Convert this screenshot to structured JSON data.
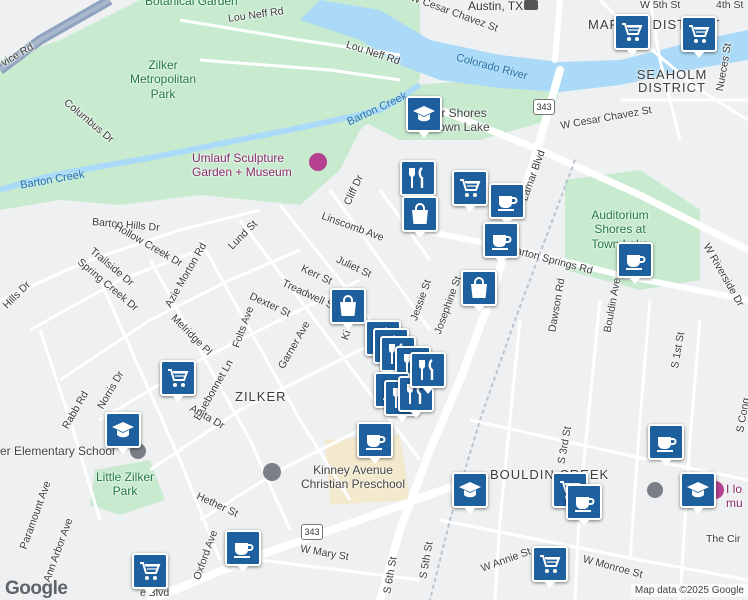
{
  "map": {
    "attribution": "Map data ©2025 Google",
    "logo": "Google",
    "colors": {
      "water": "#aadaf7",
      "park": "#c8ebd0",
      "road": "#ffffff",
      "highway": "#8fa3bf",
      "marker": "#1e5f9e",
      "school_area": "#f3e9cc"
    },
    "water_labels": [
      "Colorado River",
      "Barton Creek",
      "Barton Creek"
    ],
    "park_labels": [
      "Botanical Garden",
      "Zilker Metropolitan Park",
      "Auditorium Shores at Town Lake",
      "Little Zilker Park"
    ],
    "district_labels": [
      "MARKET DISTRICT",
      "SEAHOLM DISTRICT",
      "ZILKER",
      "BOULDIN CREEK"
    ],
    "city_label": "Austin, TX",
    "poi_labels": {
      "umlauf": "Umlauf Sculpture Garden + Museum",
      "kinney": "Kinney Avenue Christian Preschool",
      "elementary": "er Elementary School",
      "shores": "r Shores own Lake",
      "museum": "I lo mu"
    },
    "highway_shields": [
      "343",
      "343"
    ],
    "streets": [
      "Lou Neff Rd",
      "Lou Neff Rd",
      "W Cesar Chavez St",
      "W Cesar Chavez St",
      "vice Rd",
      "Columbus Dr",
      "Barton Hills Dr",
      "Hollow Creek Dr",
      "Trailside Dr",
      "Spring Creek Dr",
      "Hills Dr",
      "Azie Morton Rd",
      "Lund St",
      "Cliff Dr",
      "Linscomb Ave",
      "Juliet St",
      "Kerr St",
      "Treadwell St",
      "Dexter St",
      "Folts Ave",
      "Garner Ave",
      "Melridge Pl",
      "Bluebonnet Ln",
      "Anita Dr",
      "Norris Dr",
      "Rabb Rd",
      "Paramount Ave",
      "Ann Arbor Ave",
      "Hether St",
      "Oxford Ave",
      "W Mary St",
      "W Annie St",
      "W Monroe St",
      "S 5th St",
      "S 6th St",
      "S 3rd St",
      "S 1st St",
      "Bouldin Ave",
      "Dawson Rd",
      "W Riverside Dr",
      "Barton Springs Rd",
      "S Lamar Blvd",
      "Jessie St",
      "Josephine St",
      "The Cir",
      "S Cong",
      "Nueces St",
      "W 5th St",
      "4th St",
      "e Blvd",
      "Ki"
    ],
    "markers": [
      {
        "icon": "school"
      },
      {
        "icon": "shopping-cart"
      },
      {
        "icon": "shopping-cart"
      },
      {
        "icon": "restaurant"
      },
      {
        "icon": "shopping-cart"
      },
      {
        "icon": "shopping-bag"
      },
      {
        "icon": "coffee"
      },
      {
        "icon": "coffee"
      },
      {
        "icon": "coffee"
      },
      {
        "icon": "shopping-bag"
      },
      {
        "icon": "shopping-bag"
      },
      {
        "icon": "restaurant"
      },
      {
        "icon": "restaurant"
      },
      {
        "icon": "restaurant"
      },
      {
        "icon": "restaurant"
      },
      {
        "icon": "shopping-cart"
      },
      {
        "icon": "school"
      },
      {
        "icon": "coffee"
      },
      {
        "icon": "school"
      },
      {
        "icon": "shopping-cart"
      },
      {
        "icon": "coffee"
      },
      {
        "icon": "coffee"
      },
      {
        "icon": "school"
      },
      {
        "icon": "shopping-cart"
      },
      {
        "icon": "coffee"
      },
      {
        "icon": "shopping-cart"
      },
      {
        "icon": "coffee"
      }
    ]
  }
}
